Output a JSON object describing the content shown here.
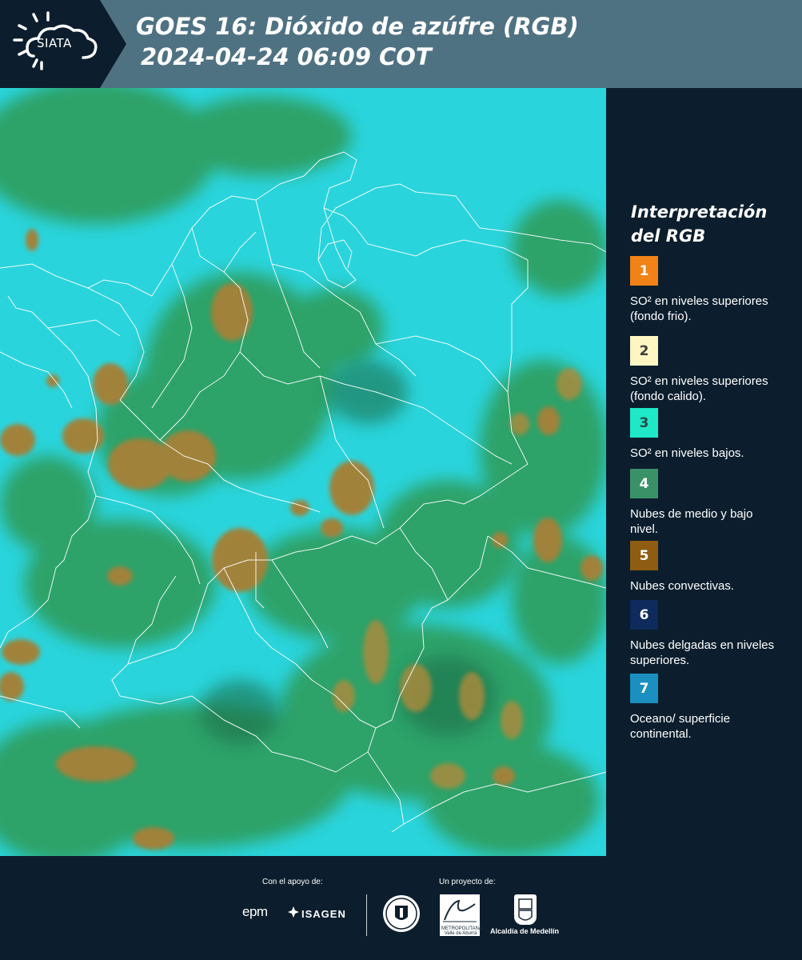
{
  "header": {
    "logo_text": "SIATA",
    "title_line1": "GOES 16: Dióxido de azúfre (RGB)",
    "title_line2": "2024-04-24 06:09 COT"
  },
  "legend": {
    "title_line1": "Interpretación",
    "title_line2": "del RGB",
    "items": [
      {
        "number": "1",
        "label": "SO² en niveles superiores (fondo frio).",
        "color": "#f08218",
        "text_color": "#ffffff"
      },
      {
        "number": "2",
        "label": "SO² en niveles superiores (fondo calido).",
        "color": "#fdf6c3",
        "text_color": "#3b3b3b"
      },
      {
        "number": "3",
        "label": "SO² en niveles bajos.",
        "color": "#1fe8c8",
        "text_color": "#2a4a4a"
      },
      {
        "number": "4",
        "label": "Nubes de medio y bajo nivel.",
        "color": "#3a9168",
        "text_color": "#ffffff"
      },
      {
        "number": "5",
        "label": "Nubes convectivas.",
        "color": "#8e5c12",
        "text_color": "#ffffff"
      },
      {
        "number": "6",
        "label": "Nubes delgadas en niveles superiores.",
        "color": "#0f2b5d",
        "text_color": "#ffffff"
      },
      {
        "number": "7",
        "label": "Oceano/ superficie continental.",
        "color": "#1a8fc0",
        "text_color": "#ffffff"
      }
    ]
  },
  "footer": {
    "support_label": "Con el apoyo de:",
    "project_label": "Un proyecto de:",
    "sponsor_epm": "epm",
    "sponsor_isagen": "ISAGEN",
    "area_text": "METROPOLITANA Valle de Aburrá",
    "alcaldia_label": "Alcaldía de Medellín"
  },
  "colors": {
    "header_bg": "#4f7283",
    "page_bg": "#0c1e2d",
    "map_cyan": "#2ad4dc",
    "map_green": "#2f9a55",
    "map_convective": "#9a7a2a"
  },
  "icons": [
    "sun-cloud-logo-icon",
    "isagen-icon",
    "university-seal-icon",
    "area-metropolitana-logo-icon",
    "alcaldia-emblem-icon"
  ]
}
